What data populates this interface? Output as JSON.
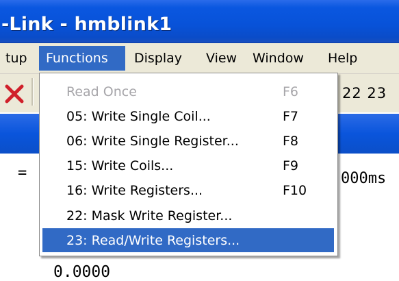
{
  "window": {
    "title": "-Link - hmblink1"
  },
  "menubar": {
    "items": [
      {
        "label": "tup"
      },
      {
        "label": "Functions"
      },
      {
        "label": "Display"
      },
      {
        "label": "View"
      },
      {
        "label": "Window"
      },
      {
        "label": "Help"
      }
    ]
  },
  "toolbar": {
    "columns": "22  23"
  },
  "content": {
    "eq": "=",
    "timeout": "000ms",
    "value": "0.0000"
  },
  "functions_menu": {
    "items": [
      {
        "label": "Read Once",
        "shortcut": "F6",
        "state": "disabled"
      },
      {
        "label": "05: Write Single Coil...",
        "shortcut": "F7",
        "state": "normal"
      },
      {
        "label": "06: Write Single Register...",
        "shortcut": "F8",
        "state": "normal"
      },
      {
        "label": "15: Write Coils...",
        "shortcut": "F9",
        "state": "normal"
      },
      {
        "label": "16: Write Registers...",
        "shortcut": "F10",
        "state": "normal"
      },
      {
        "label": "22: Mask Write Register...",
        "shortcut": "",
        "state": "normal"
      },
      {
        "label": "23: Read/Write Registers...",
        "shortcut": "",
        "state": "highlighted"
      }
    ]
  },
  "colors": {
    "title_bar": "#0852d8",
    "menu_bar": "#ece9d8",
    "highlight": "#316ac5",
    "disabled_text": "#a7a6aa",
    "close_icon": "#d0202a"
  }
}
